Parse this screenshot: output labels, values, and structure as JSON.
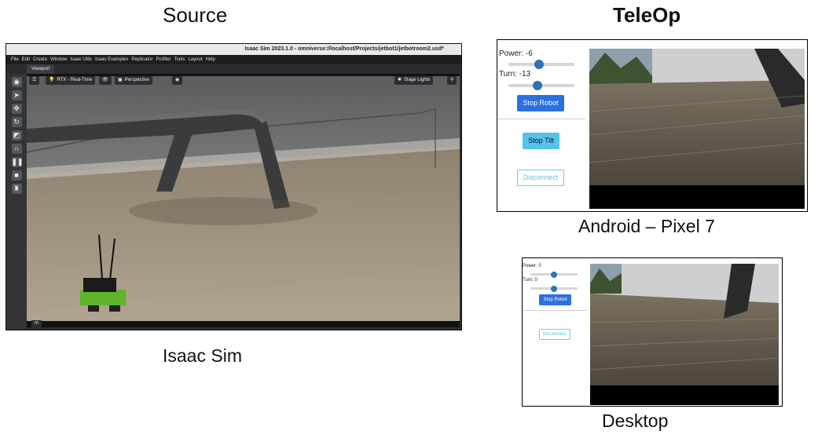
{
  "headings": {
    "source": "Source",
    "teleop": "TeleOp"
  },
  "captions": {
    "isaac": "Isaac Sim",
    "android": "Android – Pixel 7",
    "desktop": "Desktop"
  },
  "isaac": {
    "window_title": "Isaac Sim 2023.1.0 - omniverse://localhost/Projects/jetbot1/jetbotroom2.usd*",
    "menu": [
      "File",
      "Edit",
      "Create",
      "Window",
      "Isaac Utils",
      "Isaac Examples",
      "Replicator",
      "Profiler",
      "Tools",
      "Layout",
      "Help"
    ],
    "tab": "Viewport",
    "renderer": "RTX - Real-Time",
    "camera": "Perspective",
    "lights": "Stage Lights",
    "unit": "m",
    "tool_icons": [
      "camera-icon",
      "select-icon",
      "move-icon",
      "rotate-icon",
      "scale-icon",
      "snap-icon",
      "pause-icon",
      "stop-icon",
      "robot-icon"
    ]
  },
  "android": {
    "power_label": "Power: -6",
    "power_value": -6,
    "turn_label": "Turn: -13",
    "turn_value": -13,
    "stop_robot": "Stop Robot",
    "stop_tilt": "Stop Tilt",
    "disconnect": "Disconnect"
  },
  "desktop": {
    "power_label": "Power: 0",
    "power_value": 0,
    "turn_label": "Turn: 0",
    "turn_value": 0,
    "stop_robot": "Stop Robot",
    "disconnect": "Disconnect"
  },
  "colors": {
    "primary_button": "#2d6fe0",
    "tilt_button": "#55c4e8",
    "outline_button": "#6ad0ea",
    "slider_thumb": "#2f72b5",
    "jetbot_green": "#5fb42a"
  }
}
